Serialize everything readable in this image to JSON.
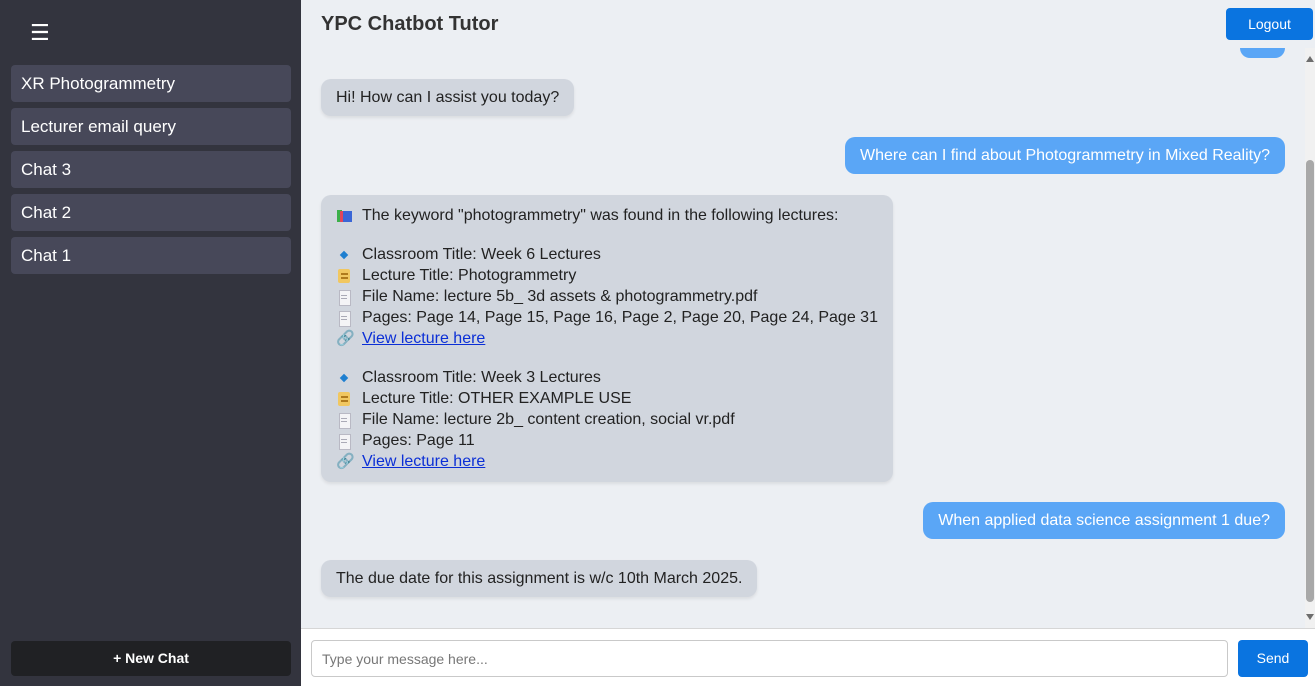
{
  "sidebar": {
    "menu_icon": "☰",
    "chats": [
      {
        "label": "XR Photogrammetry"
      },
      {
        "label": "Lecturer email query"
      },
      {
        "label": "Chat 3"
      },
      {
        "label": "Chat 2"
      },
      {
        "label": "Chat 1"
      }
    ],
    "new_chat_label": "+ New Chat"
  },
  "header": {
    "title": "YPC Chatbot Tutor",
    "logout_label": "Logout"
  },
  "messages": {
    "greeting": "Hi! How can I assist you today?",
    "user_q1": "Where can I find about Photogrammetry in Mixed Reality?",
    "result": {
      "intro": "The keyword \"photogrammetry\" was found in the following lectures:",
      "lectures": [
        {
          "classroom": "Classroom Title: Week 6 Lectures",
          "lecture": "Lecture Title: Photogrammetry",
          "file": "File Name: lecture 5b_ 3d assets & photogrammetry.pdf",
          "pages": "Pages: Page 14, Page 15, Page 16, Page 2, Page 20, Page 24, Page 31",
          "link": "View lecture here"
        },
        {
          "classroom": "Classroom Title: Week 3 Lectures",
          "lecture": "Lecture Title: OTHER EXAMPLE USE",
          "file": "File Name: lecture 2b_ content creation, social vr.pdf",
          "pages": "Pages: Page 11",
          "link": "View lecture here"
        }
      ]
    },
    "user_q2": "When applied data science assignment 1 due?",
    "answer2": "The due date for this assignment is w/c 10th March 2025."
  },
  "input": {
    "placeholder": "Type your message here...",
    "value": "",
    "send_label": "Send"
  },
  "icons": {
    "intro": "books-icon",
    "classroom": "blue-diamond-icon",
    "lecture": "scroll-icon",
    "file": "page-icon",
    "pages": "page-icon",
    "link": "link-icon"
  },
  "colors": {
    "sidebar_bg": "#33343e",
    "chat_item_bg": "#474859",
    "main_bg": "#eceff3",
    "bot_bubble": "#d1d6de",
    "user_bubble": "#5aa6f6",
    "accent": "#0a74e0",
    "link": "#0b2fd6"
  }
}
